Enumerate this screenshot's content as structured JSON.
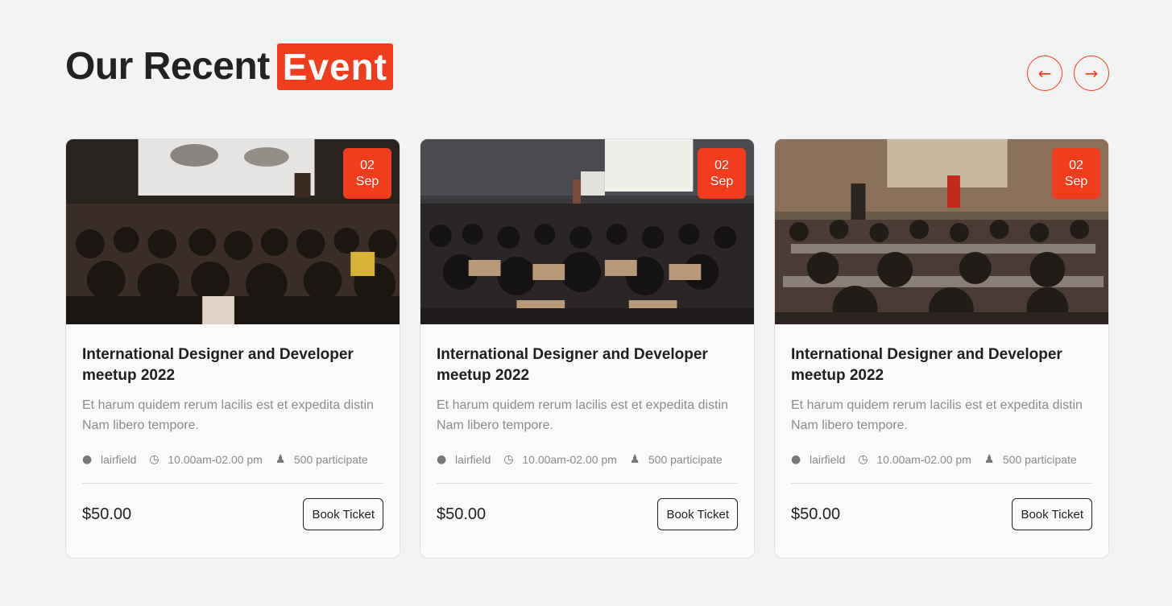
{
  "header": {
    "title": "Our Recent",
    "highlight": "Event",
    "accent_color": "#f23c1e"
  },
  "nav": {
    "prev_icon": "arrow-left-icon",
    "next_icon": "arrow-right-icon"
  },
  "events": [
    {
      "date_day": "02",
      "date_month": "Sep",
      "title": "International Designer and Developer meetup 2022",
      "description": "Et harum quidem rerum lacilis est et expedita distin Nam libero tempore.",
      "location": "lairfield",
      "time": "10.00am-02.00 pm",
      "participants": "500 participate",
      "price": "$50.00",
      "button": "Book Ticket"
    },
    {
      "date_day": "02",
      "date_month": "Sep",
      "title": "International Designer and Developer meetup 2022",
      "description": "Et harum quidem rerum lacilis est et expedita distin Nam libero tempore.",
      "location": "lairfield",
      "time": "10.00am-02.00 pm",
      "participants": "500 participate",
      "price": "$50.00",
      "button": "Book Ticket"
    },
    {
      "date_day": "02",
      "date_month": "Sep",
      "title": "International Designer and Developer meetup 2022",
      "description": "Et harum quidem rerum lacilis est et expedita distin Nam libero tempore.",
      "location": "lairfield",
      "time": "10.00am-02.00 pm",
      "participants": "500 participate",
      "price": "$50.00",
      "button": "Book Ticket"
    }
  ]
}
